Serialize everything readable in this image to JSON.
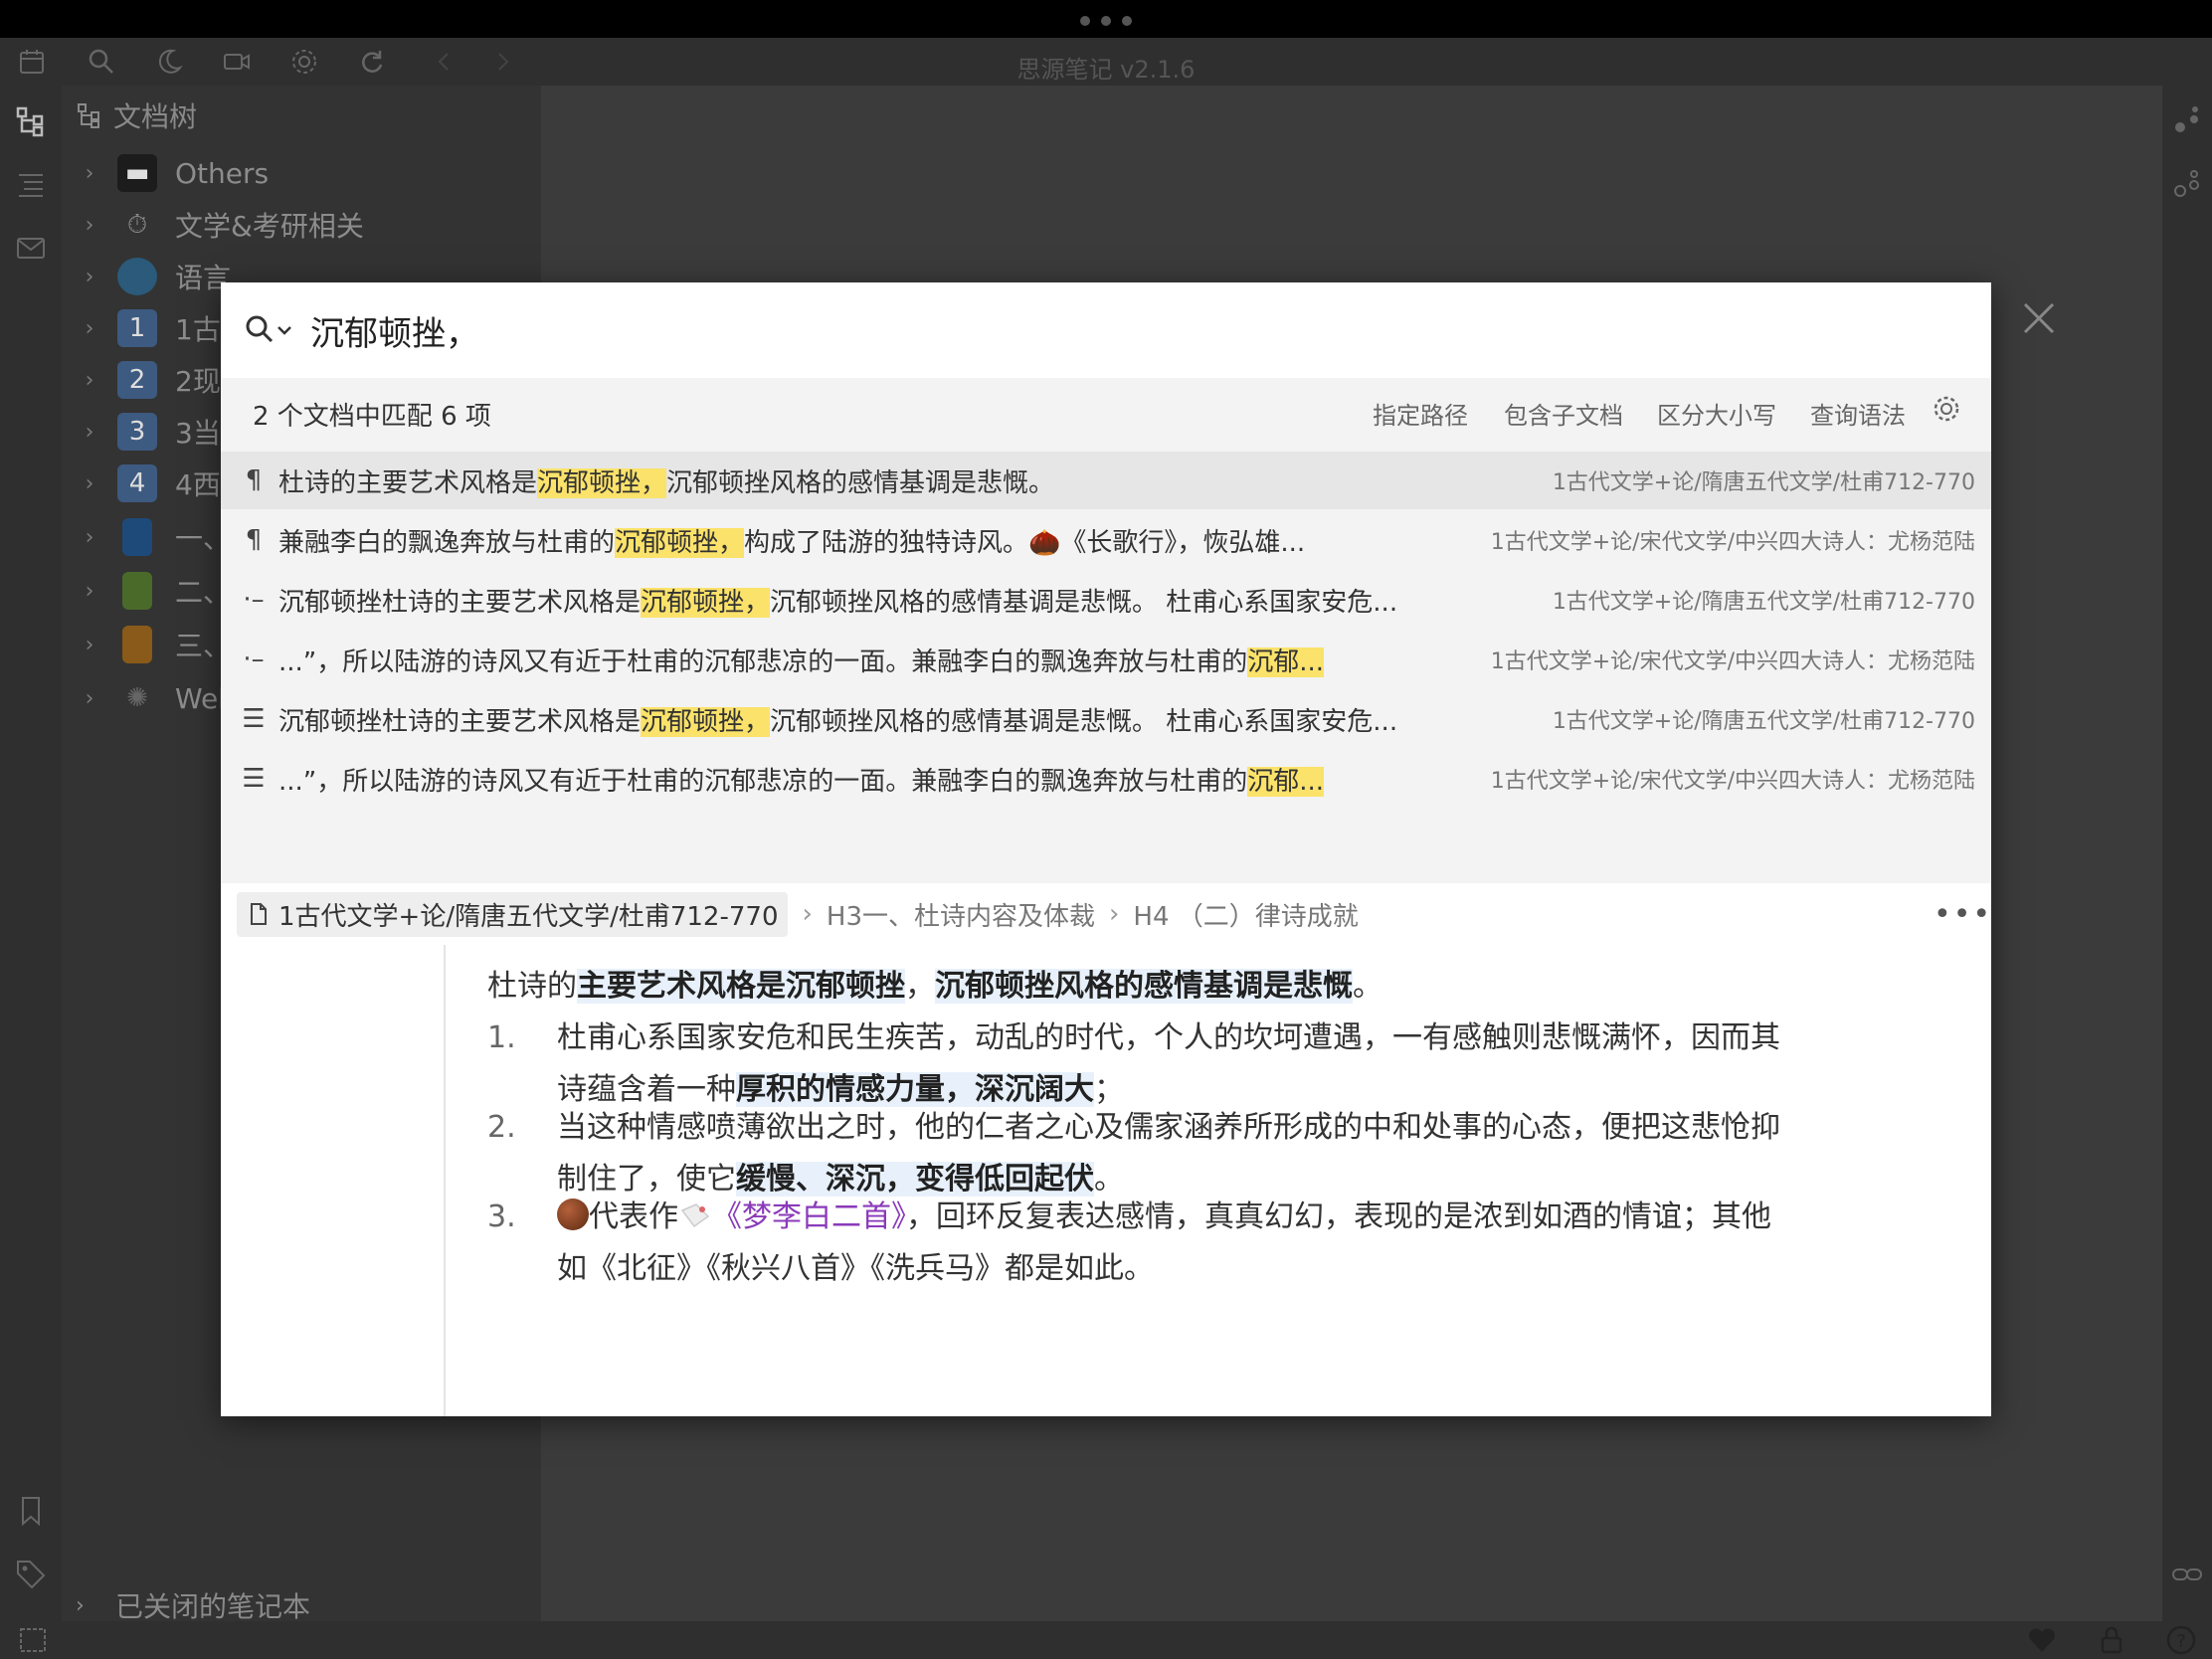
{
  "app": {
    "title": "思源笔记 v2.1.6"
  },
  "tree": {
    "header": "文档树",
    "items": [
      {
        "label": "Others",
        "icon": "film-clapper-icon"
      },
      {
        "label": "文学&考研相关",
        "icon": "stopwatch-icon"
      },
      {
        "label": "语言",
        "icon": "whale-icon"
      },
      {
        "label": "1古",
        "icon": "keycap-1-icon"
      },
      {
        "label": "2现",
        "icon": "keycap-2-icon"
      },
      {
        "label": "3当",
        "icon": "keycap-3-icon"
      },
      {
        "label": "4西",
        "icon": "keycap-4-icon"
      },
      {
        "label": "一、",
        "icon": "blue-book-icon"
      },
      {
        "label": "二、",
        "icon": "green-book-icon"
      },
      {
        "label": "三、",
        "icon": "orange-book-icon"
      },
      {
        "label": "Web",
        "icon": "spider-web-icon"
      }
    ],
    "closed_notebooks": "已关闭的笔记本"
  },
  "search": {
    "query": "沉郁顿挫，",
    "summary": "2 个文档中匹配 6 项",
    "options": [
      "指定路径",
      "包含子文档",
      "区分大小写",
      "查询语法"
    ],
    "results": [
      {
        "icon": "paragraph-icon",
        "before": "杜诗的主要艺术风格是",
        "match": "沉郁顿挫，",
        "after": "沉郁顿挫风格的感情基调是悲慨。",
        "path": "1古代文学+论/隋唐五代文学/杜甫712-770"
      },
      {
        "icon": "paragraph-icon",
        "before": "兼融李白的飘逸奔放与杜甫的",
        "match": "沉郁顿挫，",
        "after": "构成了陆游的独特诗风。🌰《长歌行》，恢弘雄...",
        "path": "1古代文学+论/宋代文学/中兴四大诗人：尤杨范陆"
      },
      {
        "icon": "list-item-icon",
        "before": "沉郁顿挫杜诗的主要艺术风格是",
        "match": "沉郁顿挫，",
        "after": "沉郁顿挫风格的感情基调是悲慨。 杜甫心系国家安危...",
        "path": "1古代文学+论/隋唐五代文学/杜甫712-770"
      },
      {
        "icon": "list-item-icon",
        "before": "...”，所以陆游的诗风又有近于杜甫的沉郁悲凉的一面。兼融李白的飘逸奔放与杜甫的",
        "match": "沉郁...",
        "after": "",
        "path": "1古代文学+论/宋代文学/中兴四大诗人：尤杨范陆"
      },
      {
        "icon": "list-icon",
        "before": "沉郁顿挫杜诗的主要艺术风格是",
        "match": "沉郁顿挫，",
        "after": "沉郁顿挫风格的感情基调是悲慨。 杜甫心系国家安危...",
        "path": "1古代文学+论/隋唐五代文学/杜甫712-770"
      },
      {
        "icon": "list-icon",
        "before": "...”，所以陆游的诗风又有近于杜甫的沉郁悲凉的一面。兼融李白的飘逸奔放与杜甫的",
        "match": "沉郁...",
        "after": "",
        "path": "1古代文学+论/宋代文学/中兴四大诗人：尤杨范陆"
      }
    ]
  },
  "preview": {
    "breadcrumb": {
      "doc": "1古代文学+论/隋唐五代文学/杜甫712-770",
      "h3_tag": "H3",
      "h3": "一、杜诗内容及体裁",
      "h4_tag": "H4",
      "h4": "（二）律诗成就"
    },
    "more": "•••",
    "lead": {
      "a": "杜诗的",
      "b1": "主要艺术风格是沉郁顿挫",
      "c": "，",
      "b2": "沉郁顿挫风格的感情基调是悲慨",
      "d": "。"
    },
    "items": [
      {
        "num": "1.",
        "a": "杜甫心系国家安危和民生疾苦，动乱的时代，个人的坎坷遭遇，一有感触则悲慨满怀，因而其诗蕴含着一种",
        "b": "厚积的情感力量，深沉阔大",
        "c": "；"
      },
      {
        "num": "2.",
        "a": "当这种情感喷薄欲出之时，他的仁者之心及儒家涵养所形成的中和处事的心态，便把这悲怆抑制住了，使它",
        "b": "缓慢、深沉，变得低回起伏",
        "c": "。"
      },
      {
        "num": "3.",
        "a": "代表作",
        "link": "《梦李白二首》",
        "c": "，回环反复表达感情，真真幻幻，表现的是浓到如酒的情谊；其他如《北征》《秋兴八首》《洗兵马》都是如此。"
      }
    ]
  }
}
